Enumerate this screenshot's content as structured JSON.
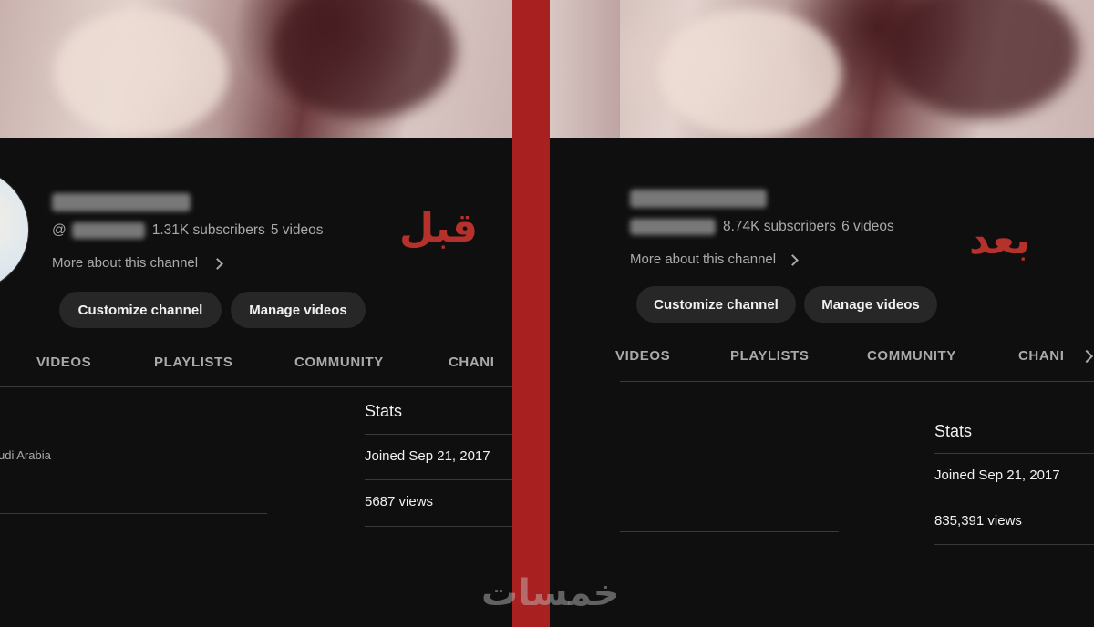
{
  "before": {
    "label": "قبل",
    "handle_prefix": "@",
    "subscribers": "1.31K subscribers",
    "videos": "5 videos",
    "more_about": "More about this channel",
    "buttons": {
      "customize": "Customize channel",
      "manage": "Manage videos"
    },
    "tabs": [
      "VIDEOS",
      "PLAYLISTS",
      "COMMUNITY",
      "CHANI"
    ],
    "location": "udi Arabia",
    "stats": {
      "title": "Stats",
      "joined": "Joined Sep 21, 2017",
      "views": "5687 views"
    }
  },
  "after": {
    "label": "بعد",
    "subscribers": "8.74K subscribers",
    "videos": "6 videos",
    "more_about": "More about this channel",
    "buttons": {
      "customize": "Customize channel",
      "manage": "Manage videos"
    },
    "tabs": [
      "VIDEOS",
      "PLAYLISTS",
      "COMMUNITY",
      "CHANI"
    ],
    "stats": {
      "title": "Stats",
      "joined": "Joined Sep 21, 2017",
      "views": "835,391 views"
    }
  },
  "watermark": "خمسات",
  "colors": {
    "divider": "#a82020",
    "label": "#b5312b",
    "background": "#0f0f0f",
    "button": "#272727"
  }
}
